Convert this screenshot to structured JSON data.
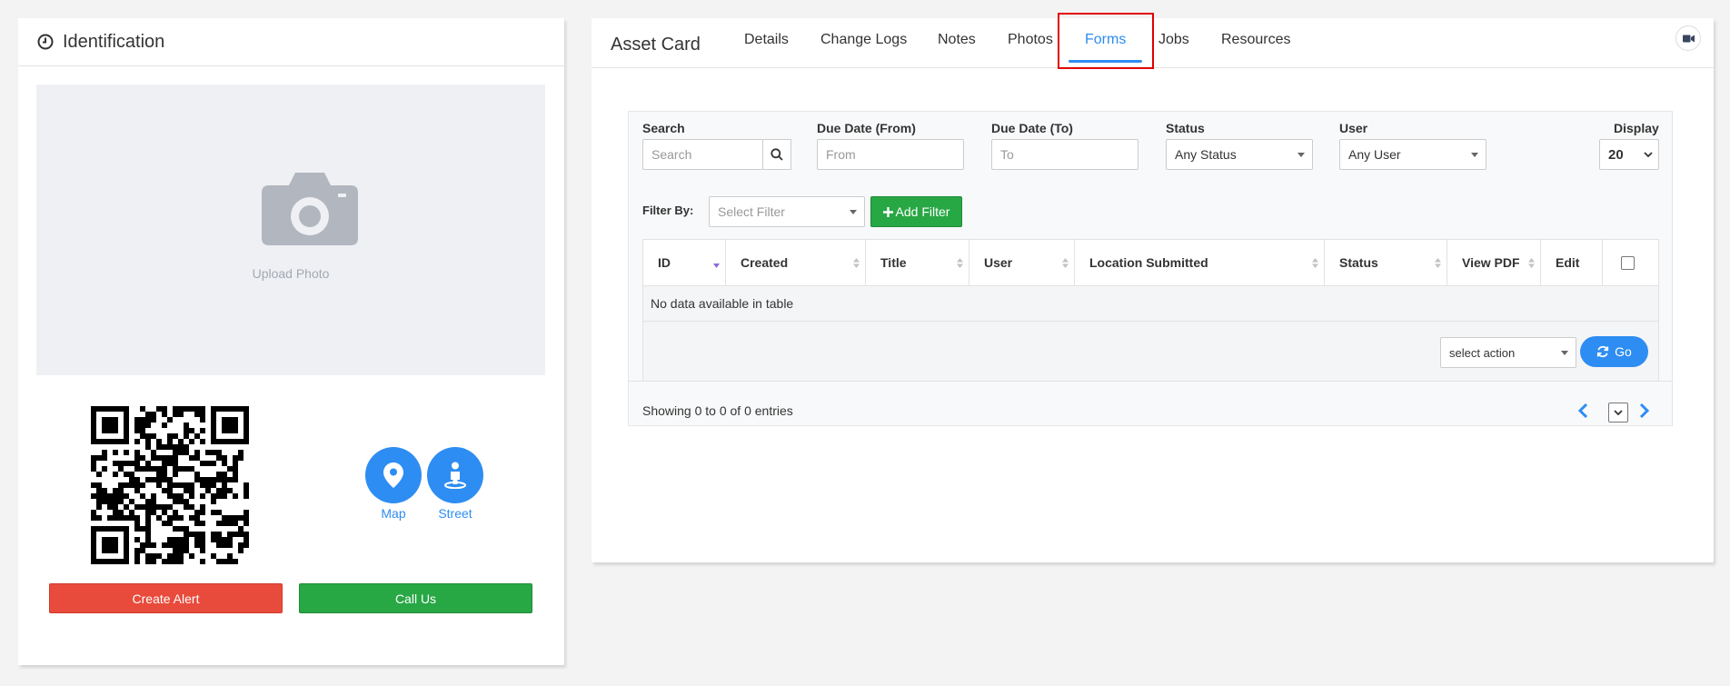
{
  "identification": {
    "title": "Identification",
    "upload_label": "Upload Photo",
    "map_label": "Map",
    "street_label": "Street",
    "create_alert_label": "Create Alert",
    "call_us_label": "Call Us"
  },
  "asset_card": {
    "title": "Asset Card",
    "tabs": [
      "Details",
      "Change Logs",
      "Notes",
      "Photos",
      "Forms",
      "Jobs",
      "Resources"
    ],
    "active_tab": "Forms"
  },
  "filters": {
    "search_label": "Search",
    "search_placeholder": "Search",
    "due_from_label": "Due Date (From)",
    "due_from_placeholder": "From",
    "due_to_label": "Due Date (To)",
    "due_to_placeholder": "To",
    "status_label": "Status",
    "status_value": "Any Status",
    "user_label": "User",
    "user_value": "Any User",
    "display_label": "Display",
    "display_value": "20",
    "filter_by_label": "Filter By:",
    "select_filter_placeholder": "Select Filter",
    "add_filter_label": "Add Filter"
  },
  "table": {
    "columns": [
      "ID",
      "Created",
      "Title",
      "User",
      "Location Submitted",
      "Status",
      "View PDF",
      "Edit"
    ],
    "empty_text": "No data available in table",
    "action_select_value": "select action",
    "go_label": "Go",
    "showing_text": "Showing 0 to 0 of 0 entries"
  },
  "colors": {
    "accent": "#2e8df2",
    "danger": "#e84b3c",
    "success": "#28a745",
    "highlight": "#e10000"
  }
}
